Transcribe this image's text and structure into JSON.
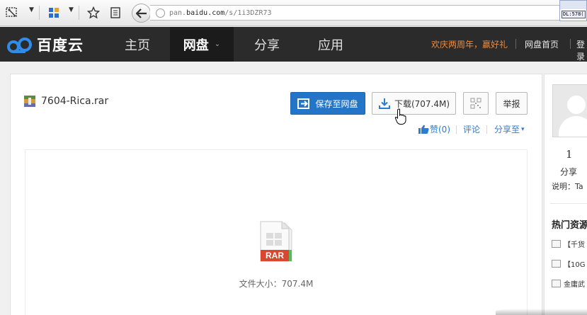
{
  "browser": {
    "url_prefix": "pan.",
    "url_domain": "baidu.com",
    "url_path": "/s/1i3DZR73",
    "corner_thumb": "DL:578(",
    "icons": [
      "snipping-icon",
      "windows-logo-icon",
      "star-icon",
      "reader-icon",
      "back-arrow-icon",
      "globe-icon"
    ]
  },
  "nav": {
    "logo_text": "百度云",
    "items": [
      {
        "label": "主页"
      },
      {
        "label": "网盘"
      },
      {
        "label": "分享"
      },
      {
        "label": "应用"
      }
    ],
    "promo": "欢庆两周年，赢好礼",
    "disk_home": "网盘首页",
    "login": "登录"
  },
  "file": {
    "name": "7604-Rica.rar",
    "save_label": "保存至网盘",
    "download_label": "下载(707.4M)",
    "report_label": "举报",
    "like_label": "赞(0)",
    "comment_label": "评论",
    "share_label": "分享至",
    "type_label": "RAR",
    "size_text": "文件大小：707.4M"
  },
  "sidebar": {
    "count": "1",
    "share_label": "分享",
    "desc": "说明：Ta",
    "hot_title": "热门资源",
    "resources": [
      "【千货",
      "【10G",
      "金庸武"
    ]
  },
  "colors": {
    "nav_bg": "#2b2b2b",
    "primary": "#2475c7",
    "promo": "#f08a38",
    "link": "#2e7bd0",
    "rar_red": "#d6482f"
  }
}
